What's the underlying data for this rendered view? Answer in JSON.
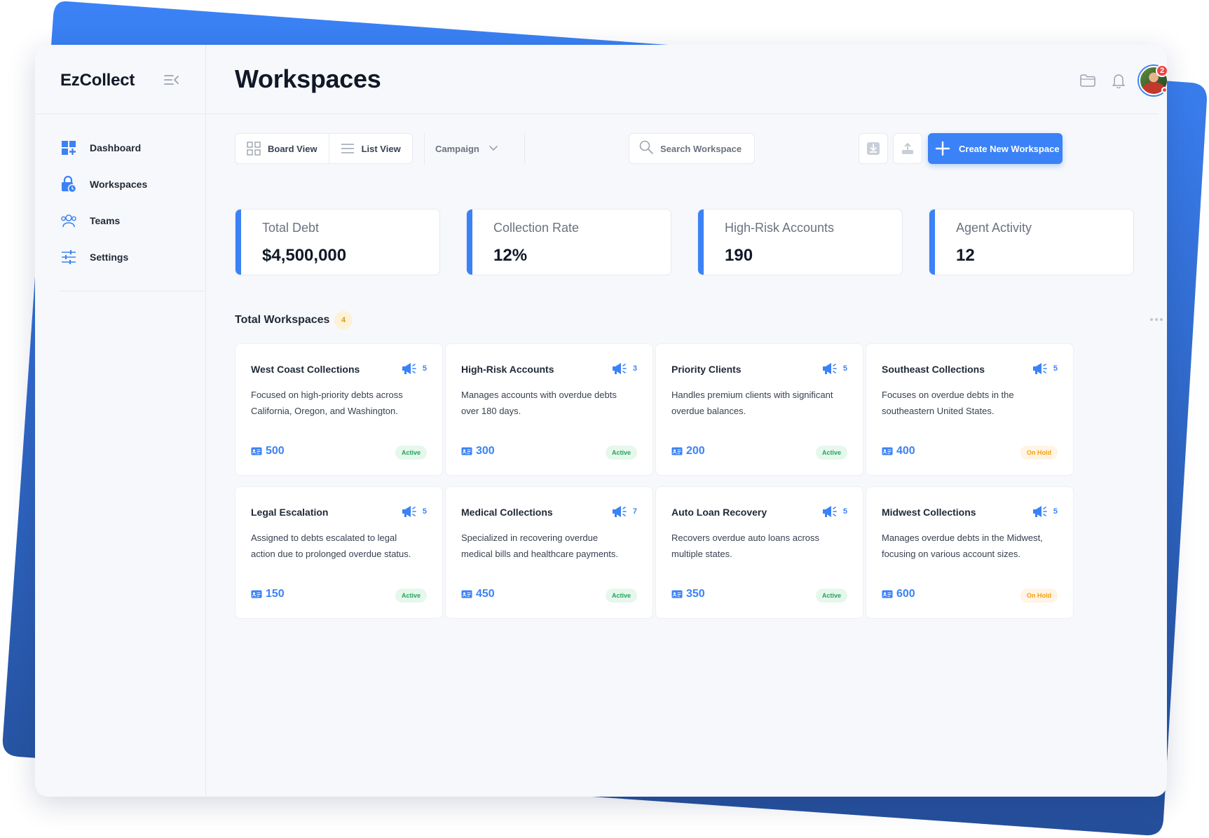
{
  "app": {
    "brand": "EzCollect",
    "page_title": "Workspaces"
  },
  "sidebar": {
    "items": [
      {
        "label": "Dashboard",
        "icon": "dashboard-icon"
      },
      {
        "label": "Workspaces",
        "icon": "workspace-lock-icon"
      },
      {
        "label": "Teams",
        "icon": "teams-icon"
      },
      {
        "label": "Settings",
        "icon": "sliders-icon"
      }
    ]
  },
  "header": {
    "notification_count": "2"
  },
  "toolbar": {
    "board_view": "Board View",
    "list_view": "List View",
    "campaign": "Campaign",
    "search_placeholder": "Search Workspace",
    "create_label": "Create New Workspace"
  },
  "stats": [
    {
      "label": "Total Debt",
      "value": "$4,500,000"
    },
    {
      "label": "Collection Rate",
      "value": "12%"
    },
    {
      "label": "High-Risk Accounts",
      "value": "190"
    },
    {
      "label": "Agent Activity",
      "value": "12"
    }
  ],
  "workspaces": {
    "title": "Total Workspaces",
    "count": "4",
    "items": [
      {
        "name": "West Coast Collections",
        "campaigns": "5",
        "description": "Focused on high-priority debts across California, Oregon, and Washington.",
        "accounts": "500",
        "status": "Active"
      },
      {
        "name": "High-Risk Accounts",
        "campaigns": "3",
        "description": "Manages accounts with overdue debts over 180 days.",
        "accounts": "300",
        "status": "Active"
      },
      {
        "name": "Priority Clients",
        "campaigns": "5",
        "description": "Handles premium clients with significant overdue balances.",
        "accounts": "200",
        "status": "Active"
      },
      {
        "name": "Southeast Collections",
        "campaigns": "5",
        "description": "Focuses on overdue debts in the southeastern United States.",
        "accounts": "400",
        "status": "On Hold"
      },
      {
        "name": "Legal Escalation",
        "campaigns": "5",
        "description": "Assigned to debts escalated to legal action due to prolonged overdue status.",
        "accounts": "150",
        "status": "Active"
      },
      {
        "name": "Medical Collections",
        "campaigns": "7",
        "description": "Specialized in recovering overdue medical bills and healthcare payments.",
        "accounts": "450",
        "status": "Active"
      },
      {
        "name": "Auto Loan Recovery",
        "campaigns": "5",
        "description": "Recovers overdue auto loans across multiple states.",
        "accounts": "350",
        "status": "Active"
      },
      {
        "name": "Midwest Collections",
        "campaigns": "5",
        "description": "Manages overdue debts in the Midwest, focusing on various account sizes.",
        "accounts": "600",
        "status": "On Hold"
      }
    ]
  },
  "colors": {
    "accent": "#3b82f6",
    "active": "#22a45d",
    "on_hold": "#f59e0b",
    "background_blue": "#2f6fe0"
  }
}
